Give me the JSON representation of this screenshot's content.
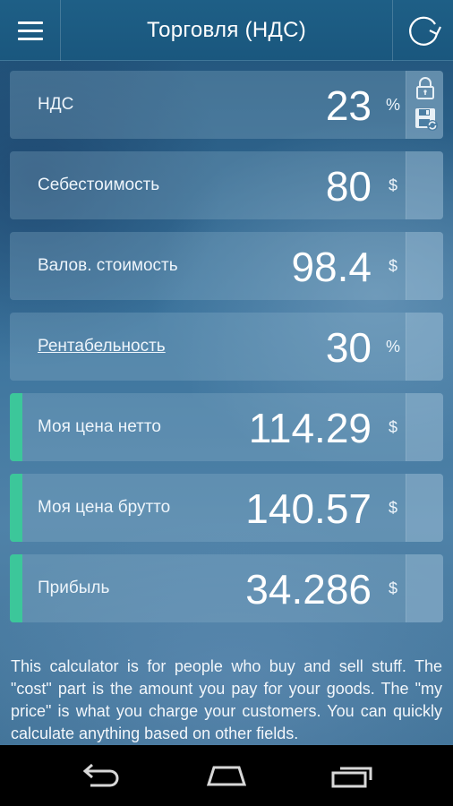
{
  "header": {
    "title": "Торговля (НДС)",
    "menu_icon": "hamburger-menu-icon",
    "refresh_icon": "refresh-icon"
  },
  "rows": [
    {
      "id": "vat",
      "label": "НДС",
      "value": "23",
      "unit": "%",
      "accent": false,
      "link": false
    },
    {
      "id": "cost",
      "label": "Себестоимость",
      "value": "80",
      "unit": "$",
      "accent": false,
      "link": false
    },
    {
      "id": "gross-cost",
      "label": "Валов. стоимость",
      "value": "98.4",
      "unit": "$",
      "accent": false,
      "link": false
    },
    {
      "id": "profitability",
      "label": "Рентабельность",
      "value": "30",
      "unit": "%",
      "accent": false,
      "link": true
    },
    {
      "id": "my-price-net",
      "label": "Моя цена нетто",
      "value": "114.29",
      "unit": "$",
      "accent": true,
      "link": false
    },
    {
      "id": "my-price-gross",
      "label": "Моя цена брутто",
      "value": "140.57",
      "unit": "$",
      "accent": true,
      "link": false
    },
    {
      "id": "profit",
      "label": "Прибыль",
      "value": "34.286",
      "unit": "$",
      "accent": true,
      "link": false
    }
  ],
  "side_icons": [
    "lock-icon",
    "save-icon"
  ],
  "description": "This calculator is for people who buy and sell stuff. The \"cost\" part is the amount you pay for your goods. The \"my price\" is what you charge your customers. You can quickly calculate anything based on other fields.",
  "navbar": {
    "icons": [
      "back-icon",
      "home-icon",
      "recent-apps-icon"
    ]
  },
  "colors": {
    "accent": "#3cc79a",
    "header": "#1a577e",
    "navbar": "#000000"
  }
}
